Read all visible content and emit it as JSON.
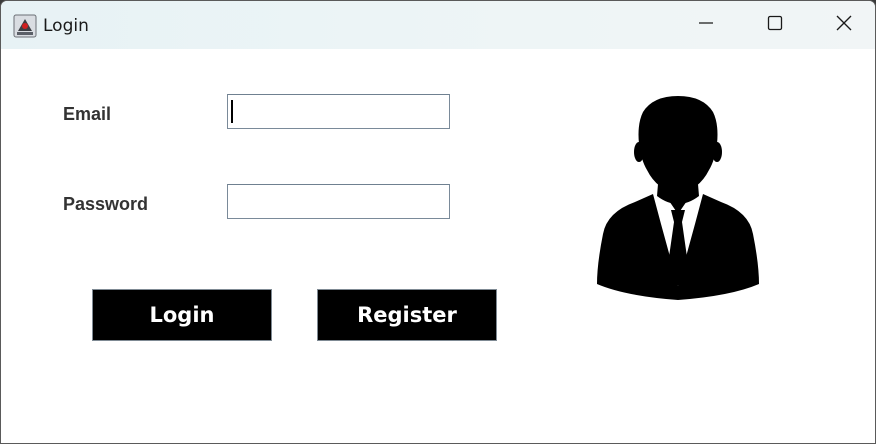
{
  "window": {
    "title": "Login",
    "app_icon": "java-cup-icon",
    "controls": {
      "minimize": "minimize-icon",
      "maximize": "maximize-icon",
      "close": "close-icon"
    }
  },
  "form": {
    "email_label": "Email",
    "email_value": "",
    "password_label": "Password",
    "password_value": ""
  },
  "buttons": {
    "login_label": "Login",
    "register_label": "Register"
  },
  "image": {
    "icon": "user-avatar-icon"
  },
  "colors": {
    "button_bg": "#000000",
    "button_text": "#ffffff",
    "label_text": "#333333",
    "titlebar_bg": "#e7f2f5"
  }
}
